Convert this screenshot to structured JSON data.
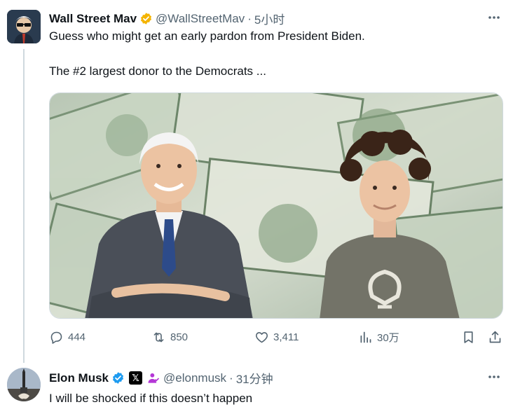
{
  "tweet1": {
    "display_name": "Wall Street Mav",
    "handle": "@WallStreetMav",
    "separator": "·",
    "time": "5小时",
    "text_line1": "Guess who might get an early pardon from President Biden.",
    "text_line2": "The #2 largest donor to the Democrats ...",
    "stats": {
      "replies": "444",
      "reposts": "850",
      "likes": "3,411",
      "views": "30万"
    }
  },
  "tweet2": {
    "display_name": "Elon Musk",
    "x_badge": "𝕏",
    "handle": "@elonmusk",
    "separator": "·",
    "time": "31分钟",
    "text": "I will be shocked if this doesn’t happen"
  },
  "colors": {
    "verified_gold": "#f4b400",
    "verified_blue": "#1d9bf0",
    "muted_text": "#536471",
    "thread_line": "#cfd9de"
  },
  "icons": [
    "verified-badge-icon",
    "more-icon",
    "reply-icon",
    "repost-icon",
    "like-icon",
    "views-icon",
    "bookmark-icon",
    "share-icon",
    "affiliate-icon"
  ]
}
